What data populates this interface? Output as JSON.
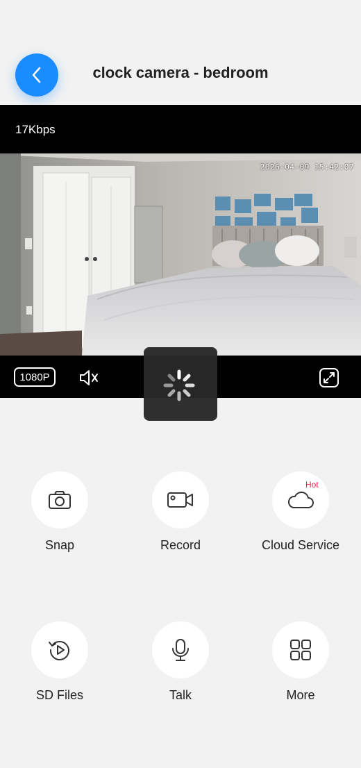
{
  "header": {
    "title": "clock camera - bedroom",
    "back_icon": "chevron-left-icon",
    "accent": "#1a8cff"
  },
  "video": {
    "bitrate": "17Kbps",
    "timestamp": "2026-04-09 15:42:07",
    "resolution": "1080P",
    "mute_icon": "speaker-muted-icon",
    "fullscreen_icon": "fullscreen-icon",
    "loading": true
  },
  "actions": [
    {
      "label": "Snap",
      "icon": "camera-icon"
    },
    {
      "label": "Record",
      "icon": "video-camera-icon"
    },
    {
      "label": "Cloud Service",
      "icon": "cloud-icon",
      "badge": "Hot"
    },
    {
      "label": "SD Files",
      "icon": "playback-icon"
    },
    {
      "label": "Talk",
      "icon": "microphone-icon"
    },
    {
      "label": "More",
      "icon": "grid-icon"
    }
  ],
  "colors": {
    "hot_badge": "#e8264a",
    "page_bg": "#f2f2f2"
  }
}
